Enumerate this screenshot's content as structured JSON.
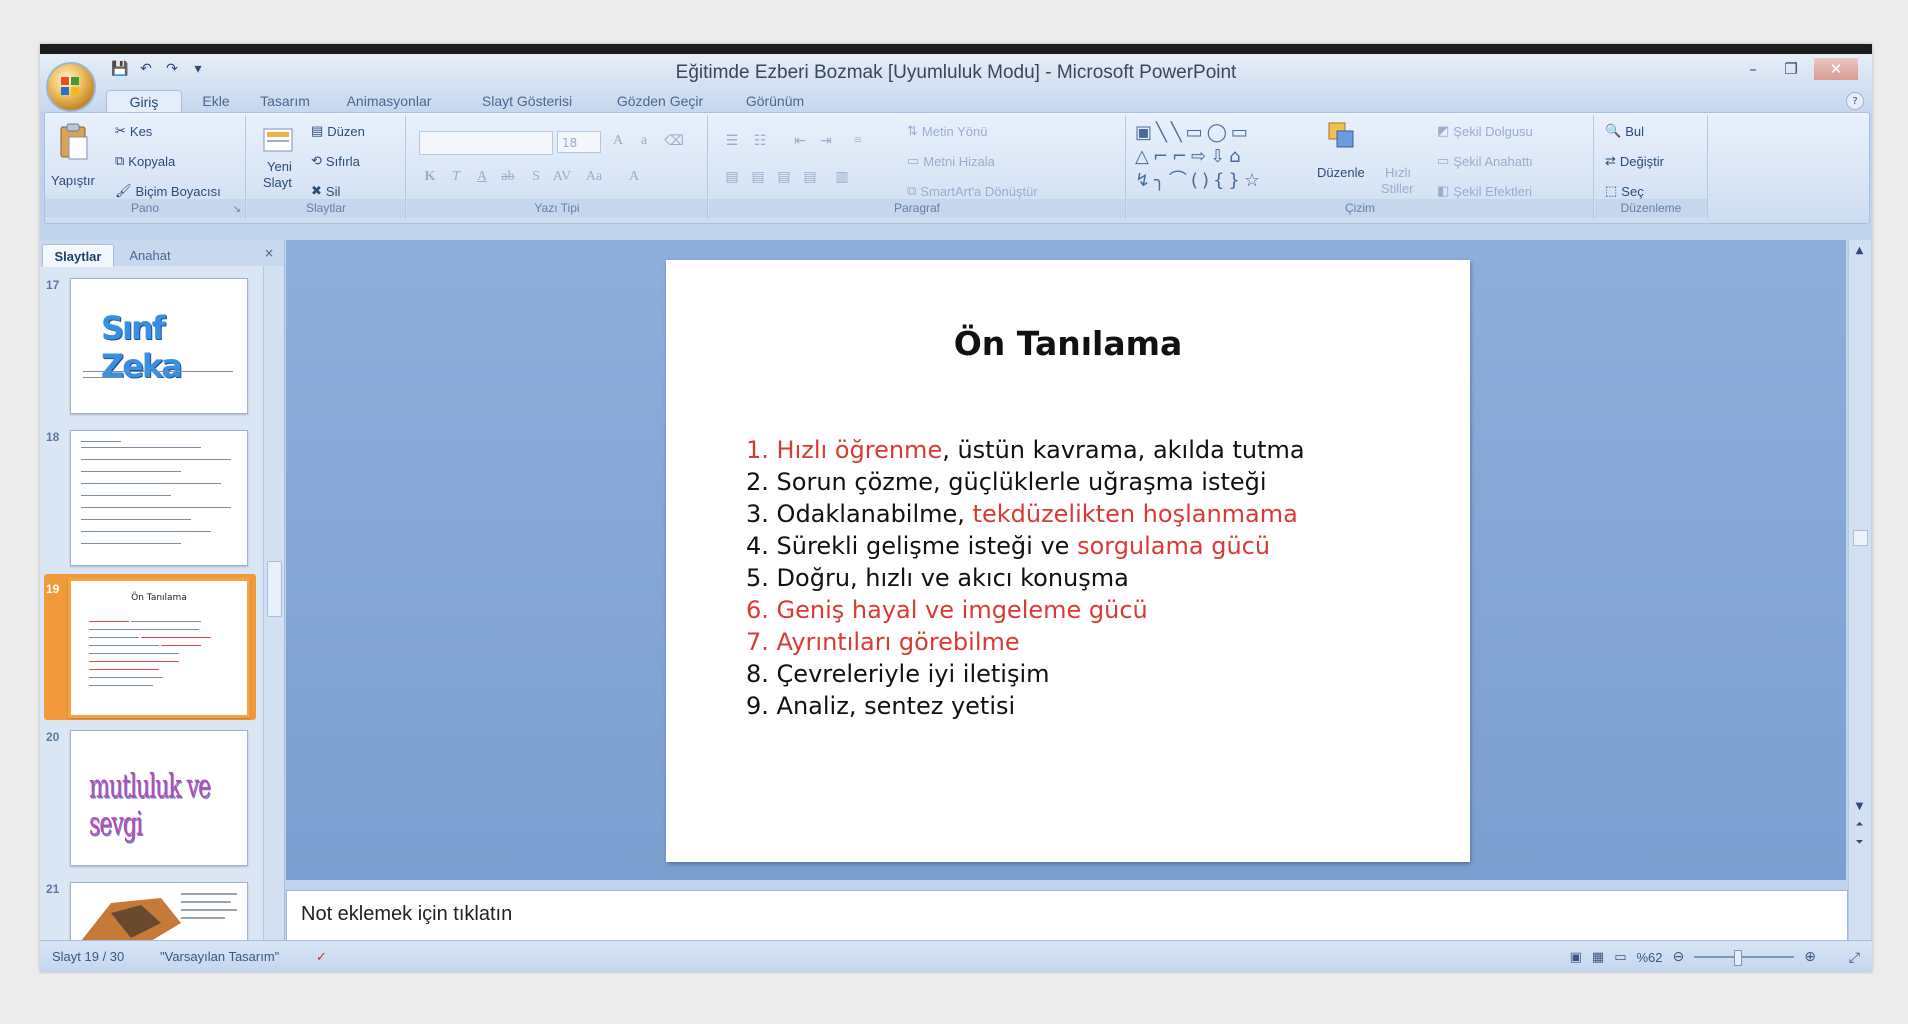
{
  "window": {
    "title": "Eğitimde Ezberi Bozmak [Uyumluluk Modu] - Microsoft PowerPoint",
    "controls": {
      "minimize": "–",
      "restore": "❐",
      "close": "✕"
    }
  },
  "qat": {
    "save": "💾",
    "undo": "↶",
    "redo": "↷",
    "customize": "▾"
  },
  "tabs": [
    {
      "label": "Giriş",
      "active": true
    },
    {
      "label": "Ekle",
      "active": false
    },
    {
      "label": "Tasarım",
      "active": false
    },
    {
      "label": "Animasyonlar",
      "active": false
    },
    {
      "label": "Slayt Gösterisi",
      "active": false
    },
    {
      "label": "Gözden Geçir",
      "active": false
    },
    {
      "label": "Görünüm",
      "active": false
    }
  ],
  "ribbon": {
    "pano": {
      "label": "Pano",
      "paste": "Yapıştır",
      "cut": "Kes",
      "copy": "Kopyala",
      "format_painter": "Biçim Boyacısı"
    },
    "slaytlar": {
      "label": "Slaytlar",
      "new_slide": "Yeni",
      "new_slide_2": "Slayt",
      "layout": "Düzen",
      "reset": "Sıfırla",
      "delete": "Sil"
    },
    "yazi_tipi": {
      "label": "Yazı Tipi",
      "font_size": "18"
    },
    "paragraf": {
      "label": "Paragraf",
      "text_direction": "Metin Yönü",
      "align_text": "Metni Hizala",
      "smartart": "SmartArt'a Dönüştür"
    },
    "cizim": {
      "label": "Çizim",
      "arrange": "Düzenle",
      "quick_styles": "Hızlı",
      "quick_styles_2": "Stiller",
      "shape_fill": "Şekil Dolgusu",
      "shape_outline": "Şekil Anahattı",
      "shape_effects": "Şekil Efektleri"
    },
    "duzenleme": {
      "label": "Düzenleme",
      "find": "Bul",
      "replace": "Değiştir",
      "select": "Seç"
    }
  },
  "left_panel": {
    "tab_slides": "Slaytlar",
    "tab_outline": "Anahat",
    "close": "×",
    "thumbnails": [
      {
        "number": "17",
        "title": "Sınf Zeka",
        "selected": false
      },
      {
        "number": "18",
        "title": "",
        "selected": false
      },
      {
        "number": "19",
        "title": "Ön Tanılama",
        "selected": true
      },
      {
        "number": "20",
        "title": "mutluluk ve sevgi",
        "selected": false
      },
      {
        "number": "21",
        "title": "",
        "selected": false
      }
    ]
  },
  "slide": {
    "title": "Ön Tanılama",
    "items": [
      {
        "num": "1.",
        "parts": [
          {
            "text": "Hızlı öğrenme",
            "red": true
          },
          {
            "text": ", üstün kavrama, akılda tutma",
            "red": false
          }
        ],
        "num_red": true
      },
      {
        "num": "2.",
        "parts": [
          {
            "text": "Sorun çözme, güçlüklerle uğraşma isteği",
            "red": false
          }
        ],
        "num_red": false
      },
      {
        "num": "3.",
        "parts": [
          {
            "text": "Odaklanabilme, ",
            "red": false
          },
          {
            "text": "tekdüzelikten hoşlanmama",
            "red": true
          }
        ],
        "num_red": false
      },
      {
        "num": "4.",
        "parts": [
          {
            "text": "Sürekli gelişme isteği ve  ",
            "red": false
          },
          {
            "text": "sorgulama gücü",
            "red": true
          }
        ],
        "num_red": false
      },
      {
        "num": "5.",
        "parts": [
          {
            "text": "Doğru, hızlı ve akıcı konuşma",
            "red": false
          }
        ],
        "num_red": false
      },
      {
        "num": "6.",
        "parts": [
          {
            "text": "Geniş hayal ve imgeleme gücü",
            "red": true
          }
        ],
        "num_red": true
      },
      {
        "num": "7.",
        "parts": [
          {
            "text": "Ayrıntıları görebilme",
            "red": true
          }
        ],
        "num_red": true
      },
      {
        "num": "8.",
        "parts": [
          {
            "text": "Çevreleriyle iyi iletişim",
            "red": false
          }
        ],
        "num_red": false
      },
      {
        "num": "9.",
        "parts": [
          {
            "text": "Analiz, sentez yetisi",
            "red": false
          }
        ],
        "num_red": false
      }
    ]
  },
  "notes": {
    "placeholder": "Not eklemek için tıklatın"
  },
  "status": {
    "slide_counter": "Slayt 19 / 30",
    "theme": "\"Varsayılan Tasarım\"",
    "zoom": "%62"
  },
  "colors": {
    "accent_red": "#d93b34",
    "selection_orange": "#f09a3b",
    "ribbon_blue": "#dae6f6"
  }
}
